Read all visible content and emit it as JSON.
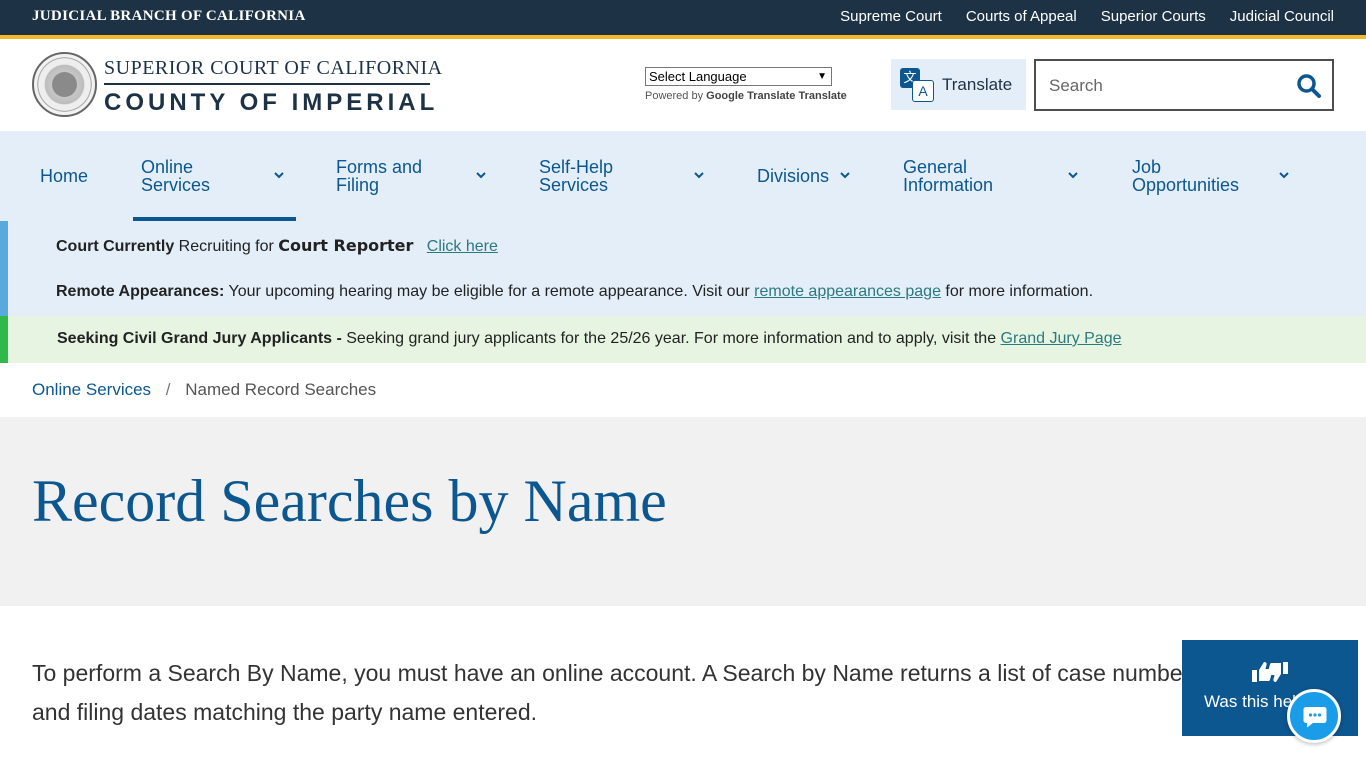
{
  "topbar": {
    "brand": "JUDICIAL BRANCH OF CALIFORNIA",
    "links": [
      "Supreme Court",
      "Courts of Appeal",
      "Superior Courts",
      "Judicial Council"
    ]
  },
  "header": {
    "logo_line1": "SUPERIOR COURT OF CALIFORNIA",
    "logo_line2": "COUNTY OF IMPERIAL",
    "language_select": "Select Language",
    "powered_by": "Powered by",
    "powered_brand": "Google Translate",
    "powered_translate": "Translate",
    "translate_label": "Translate",
    "search_placeholder": "Search"
  },
  "nav": {
    "items": [
      {
        "label": "Home"
      },
      {
        "label": "Online Services",
        "line1": "Online",
        "line2": "Services"
      },
      {
        "label": "Forms and Filing",
        "line1": "Forms and",
        "line2": "Filing"
      },
      {
        "label": "Self-Help Services",
        "line1": "Self-Help",
        "line2": "Services"
      },
      {
        "label": "Divisions"
      },
      {
        "label": "General Information",
        "line1": "General",
        "line2": "Information"
      },
      {
        "label": "Job Opportunities",
        "line1": "Job",
        "line2": "Opportunities"
      }
    ]
  },
  "alerts": {
    "reporter": {
      "bold1": "Court Currently",
      "text": " Recruiting for ",
      "bold2": "Court Reporter",
      "link": "Click here"
    },
    "remote": {
      "bold": "Remote Appearances:",
      "text": " Your upcoming hearing may be eligible for a remote appearance. Visit our ",
      "link": "remote appearances page",
      "tail": " for more information."
    },
    "jury": {
      "bold": "Seeking Civil Grand Jury Applicants -",
      "text": " Seeking grand jury applicants for the 25/26 year. For more information and to apply, visit the ",
      "link": "Grand Jury Page"
    }
  },
  "breadcrumb": {
    "parent": "Online Services",
    "separator": "/",
    "current": "Named Record Searches"
  },
  "page": {
    "title": "Record Searches by Name",
    "intro": "To perform a Search By Name, you must have an online account. A Search by Name returns a list of case numbers and filing dates matching the party name entered."
  },
  "feedback": {
    "label": "Was this helpful?"
  },
  "colors": {
    "navy": "#1e3246",
    "gold": "#f1b82d",
    "primary_blue": "#0c5790",
    "nav_bg": "#e3eef8",
    "alert_green_bg": "#e6f4e1",
    "chat_blue": "#1a9ce8"
  }
}
